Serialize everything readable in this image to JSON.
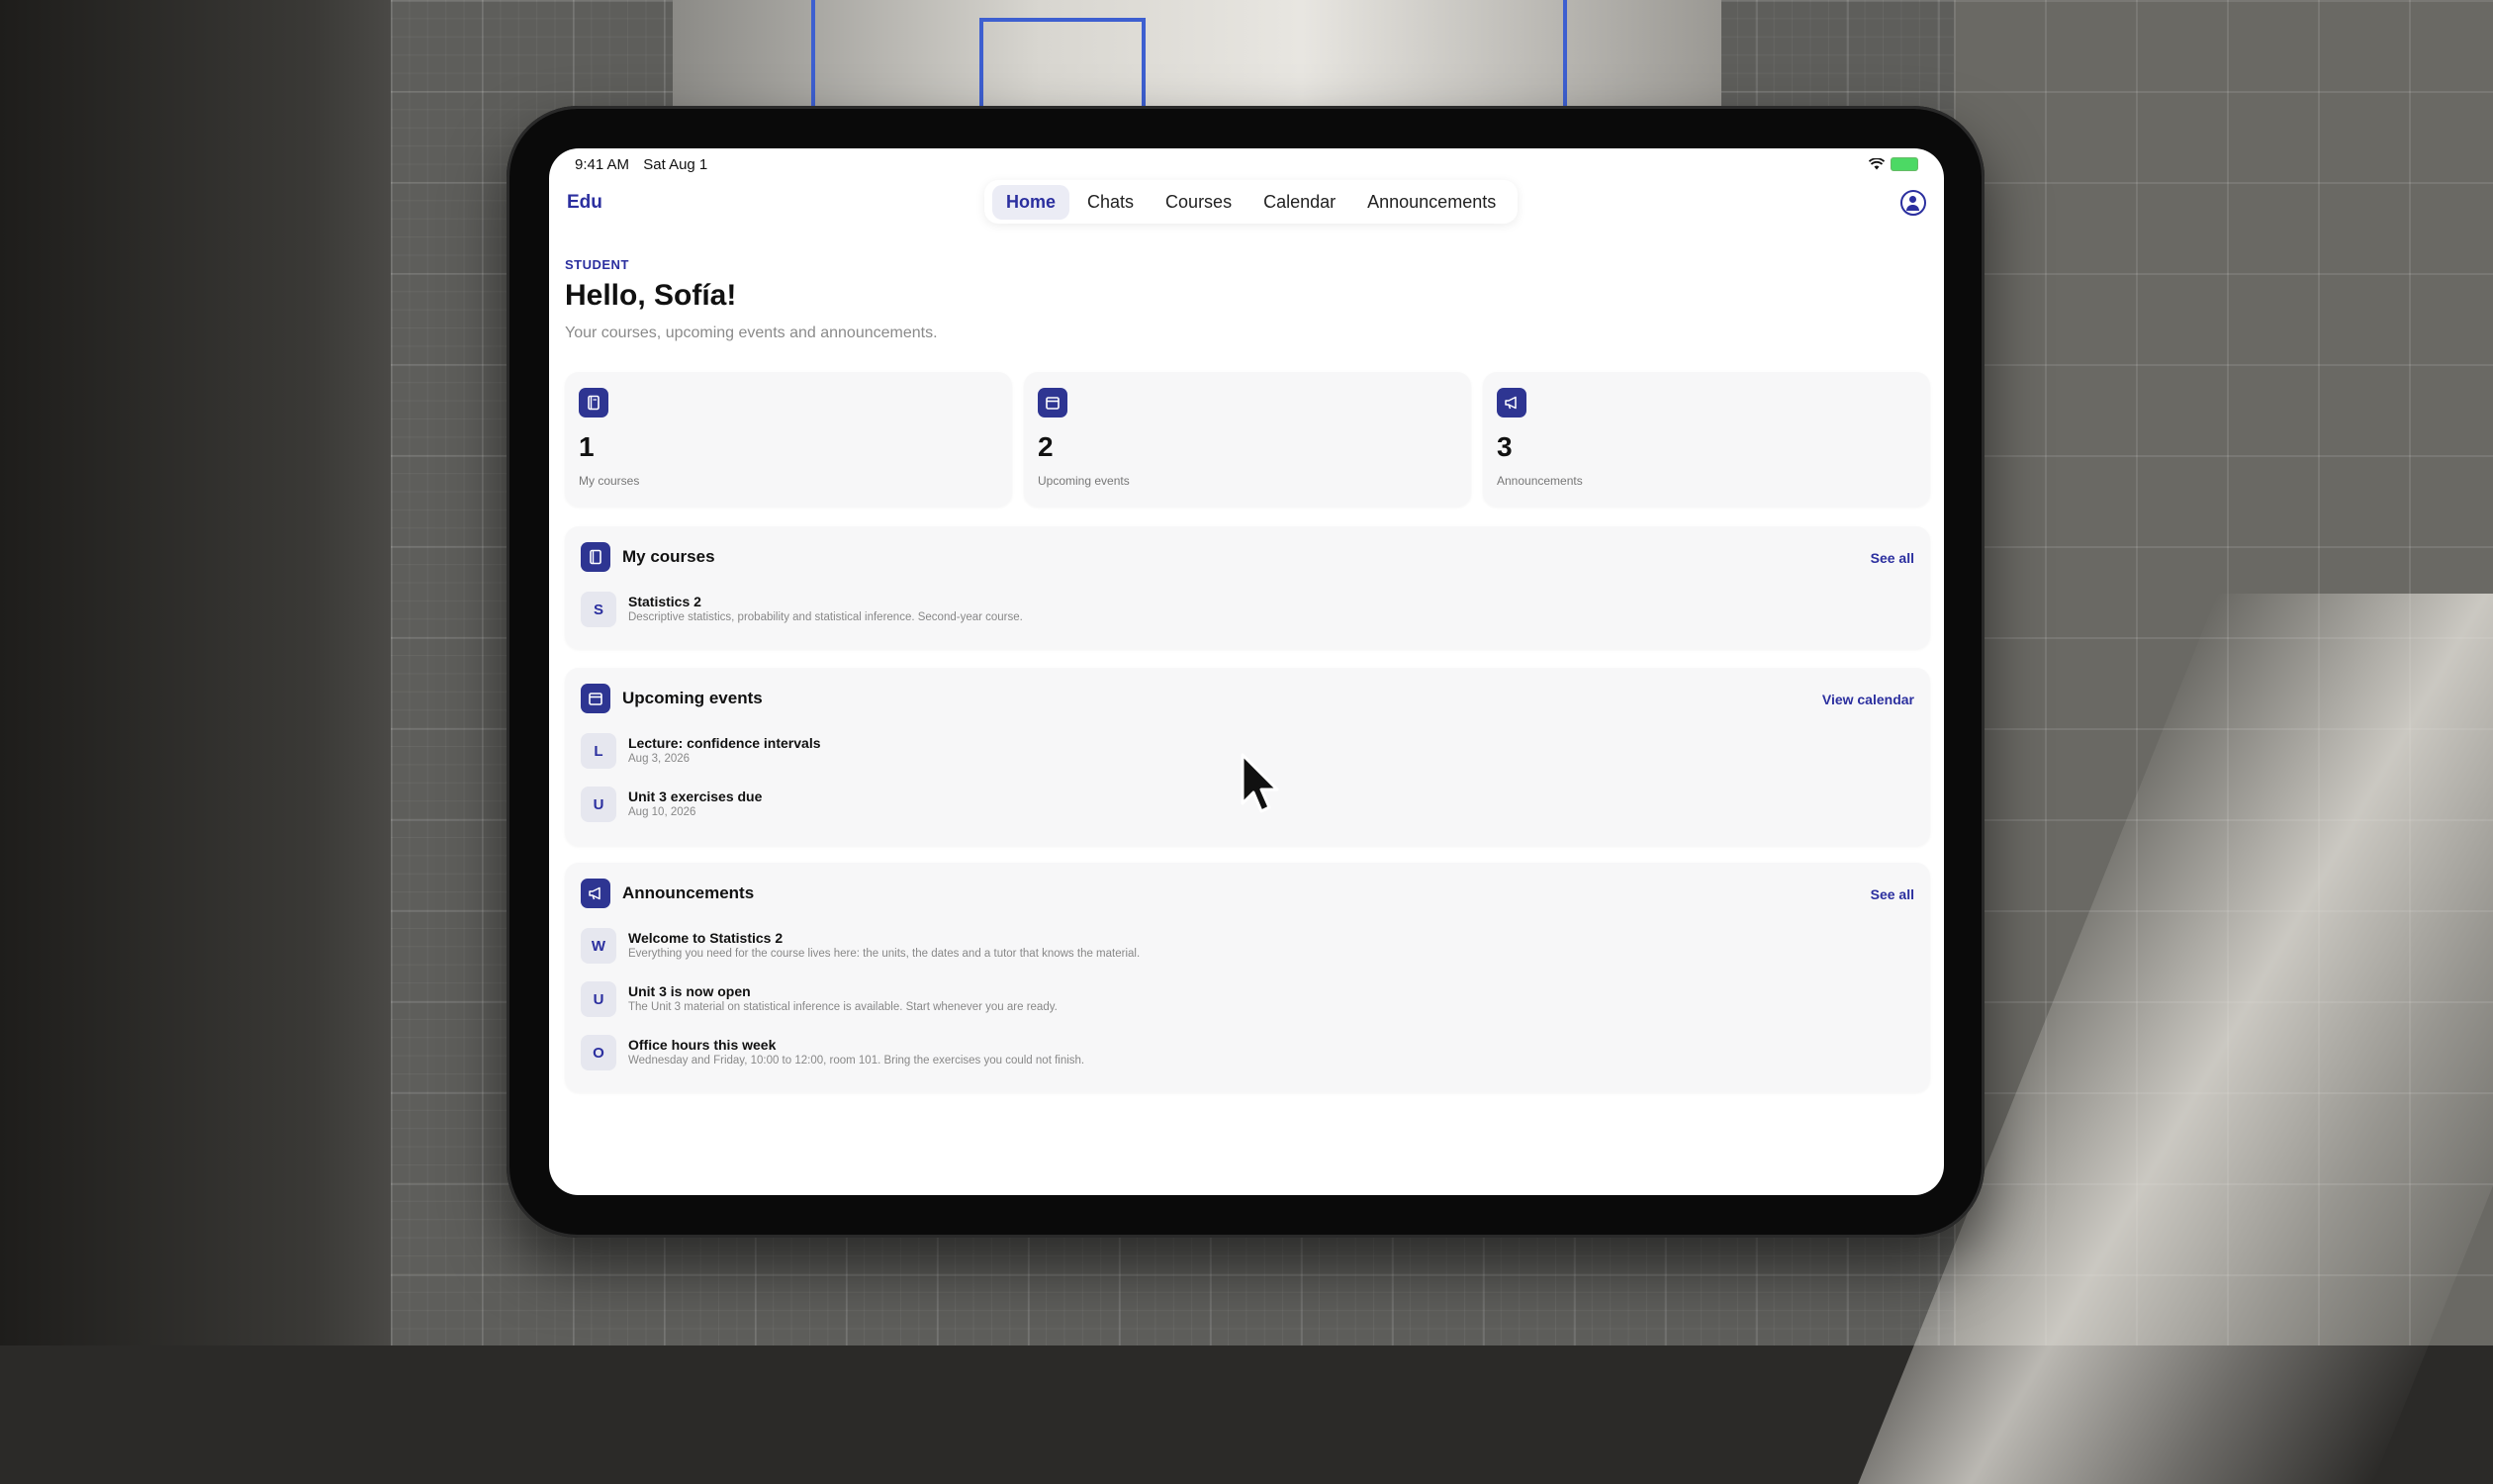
{
  "status_bar": {
    "time": "9:41 AM",
    "date": "Sat Aug 1"
  },
  "app": {
    "brand": "Edu"
  },
  "nav": {
    "tabs": [
      {
        "label": "Home",
        "active": true
      },
      {
        "label": "Chats",
        "active": false
      },
      {
        "label": "Courses",
        "active": false
      },
      {
        "label": "Calendar",
        "active": false
      },
      {
        "label": "Announcements",
        "active": false
      }
    ]
  },
  "header": {
    "role": "STUDENT",
    "greeting": "Hello, Sofía!",
    "subtitle": "Your courses, upcoming events and announcements."
  },
  "stats": [
    {
      "value": "1",
      "label": "My courses",
      "icon": "book-icon"
    },
    {
      "value": "2",
      "label": "Upcoming events",
      "icon": "calendar-icon"
    },
    {
      "value": "3",
      "label": "Announcements",
      "icon": "megaphone-icon"
    }
  ],
  "courses": {
    "title": "My courses",
    "link": "See all",
    "items": [
      {
        "initial": "S",
        "title": "Statistics 2",
        "subtitle": "Descriptive statistics, probability and statistical inference. Second-year course."
      }
    ]
  },
  "events": {
    "title": "Upcoming events",
    "link": "View calendar",
    "items": [
      {
        "initial": "L",
        "title": "Lecture: confidence intervals",
        "subtitle": "Aug 3, 2026"
      },
      {
        "initial": "U",
        "title": "Unit 3 exercises due",
        "subtitle": "Aug 10, 2026"
      }
    ]
  },
  "announcements": {
    "title": "Announcements",
    "link": "See all",
    "items": [
      {
        "initial": "W",
        "title": "Welcome to Statistics 2",
        "subtitle": "Everything you need for the course lives here: the units, the dates and a tutor that knows the material."
      },
      {
        "initial": "U",
        "title": "Unit 3 is now open",
        "subtitle": "The Unit 3 material on statistical inference is available. Start whenever you are ready."
      },
      {
        "initial": "O",
        "title": "Office hours this week",
        "subtitle": "Wednesday and Friday, 10:00 to 12:00, room 101. Bring the exercises you could not finish."
      }
    ]
  },
  "colors": {
    "accent": "#2b2f9f",
    "icon_bg": "#2e3592",
    "card_bg": "#f7f7f8"
  }
}
